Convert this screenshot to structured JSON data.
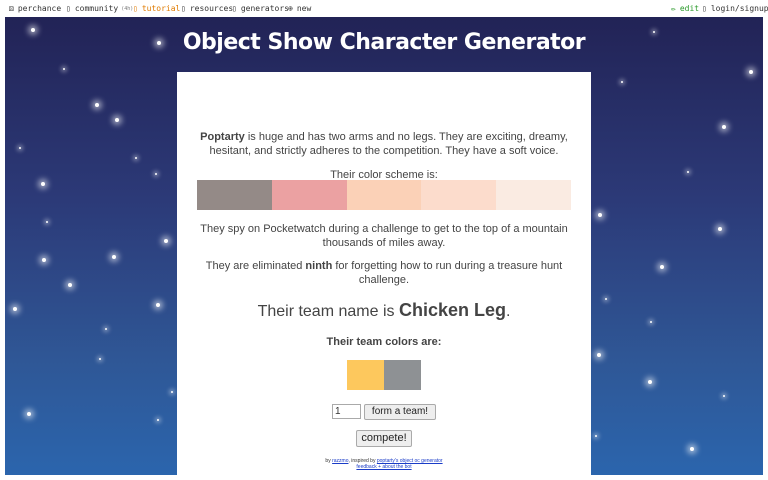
{
  "nav": {
    "brand": "perchance",
    "community": "community",
    "community_count": "(4h)",
    "tutorial": "tutorial",
    "resources": "resources",
    "generators": "generators",
    "new": "new",
    "edit": "edit",
    "login": "login/signup"
  },
  "page": {
    "title": "Object Show Character Generator"
  },
  "character": {
    "name": "Poptarty",
    "description": "is huge and has two arms and no legs. They are exciting, dreamy, hesitant, and strictly adheres to the competition. They have a soft voice.",
    "color_scheme_label": "Their color scheme is:",
    "color_scheme": [
      "#948a87",
      "#eba1a2",
      "#fbd1b7",
      "#fcdccc",
      "#faebe2"
    ],
    "spy_text": "They spy on Pocketwatch during a challenge to get to the top of a mountain thousands of miles away.",
    "elim_prefix": "They are eliminated",
    "elim_place": "ninth",
    "elim_suffix": "for forgetting how to run during a treasure hunt challenge."
  },
  "team": {
    "name_prefix": "Their team name is",
    "name": "Chicken Leg",
    "name_suffix": ".",
    "colors_label": "Their team colors are:",
    "colors": [
      "#fdc85d",
      "#8e9194"
    ]
  },
  "controls": {
    "quantity": "1",
    "form_team_label": "form a team!",
    "compete_label": "compete!"
  },
  "credit": {
    "by": "by",
    "author": "razzmo",
    "inspired": ", inspired by",
    "inspiration": "poptarty's object oc generator",
    "feedback": "feedback + about the bot"
  }
}
